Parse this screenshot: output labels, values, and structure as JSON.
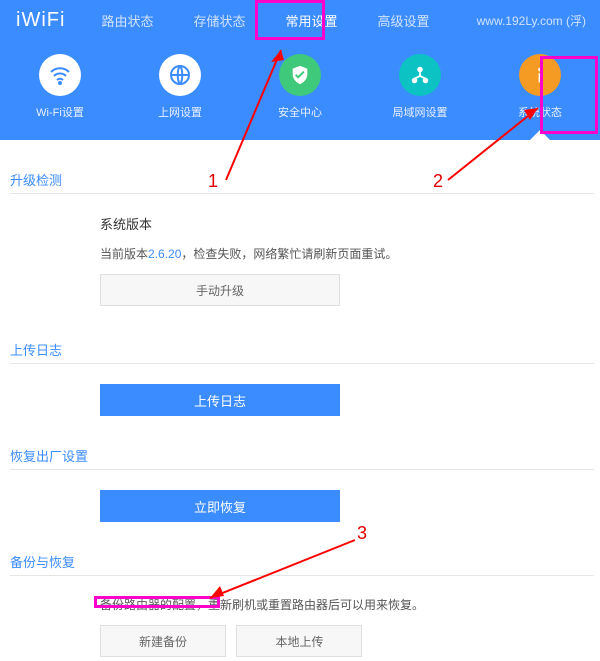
{
  "logo": "iWiFi",
  "domain": "www.192Ly.com (浮)",
  "nav": {
    "n0": "路由状态",
    "n1": "存储状态",
    "n2": "常用设置",
    "n3": "高级设置"
  },
  "icons": {
    "i0": "Wi-Fi设置",
    "i1": "上网设置",
    "i2": "安全中心",
    "i3": "局域网设置",
    "i4": "系统状态"
  },
  "sections": {
    "upgrade": "升级检测",
    "log": "上传日志",
    "factory": "恢复出厂设置",
    "backup": "备份与恢复"
  },
  "upgrade": {
    "heading": "系统版本",
    "prefix": "当前版本",
    "version": "2.6.20",
    "suffix": "，检查失败，网络繁忙请刷新页面重试。",
    "btn": "手动升级"
  },
  "log": {
    "btn": "上传日志"
  },
  "factory": {
    "btn": "立即恢复"
  },
  "backup": {
    "desc": "备份路由器的配置，重新刷机或重置路由器后可以用来恢复。",
    "btn1": "新建备份",
    "btn2": "本地上传"
  },
  "ann": {
    "n1": "1",
    "n2": "2",
    "n3": "3"
  }
}
